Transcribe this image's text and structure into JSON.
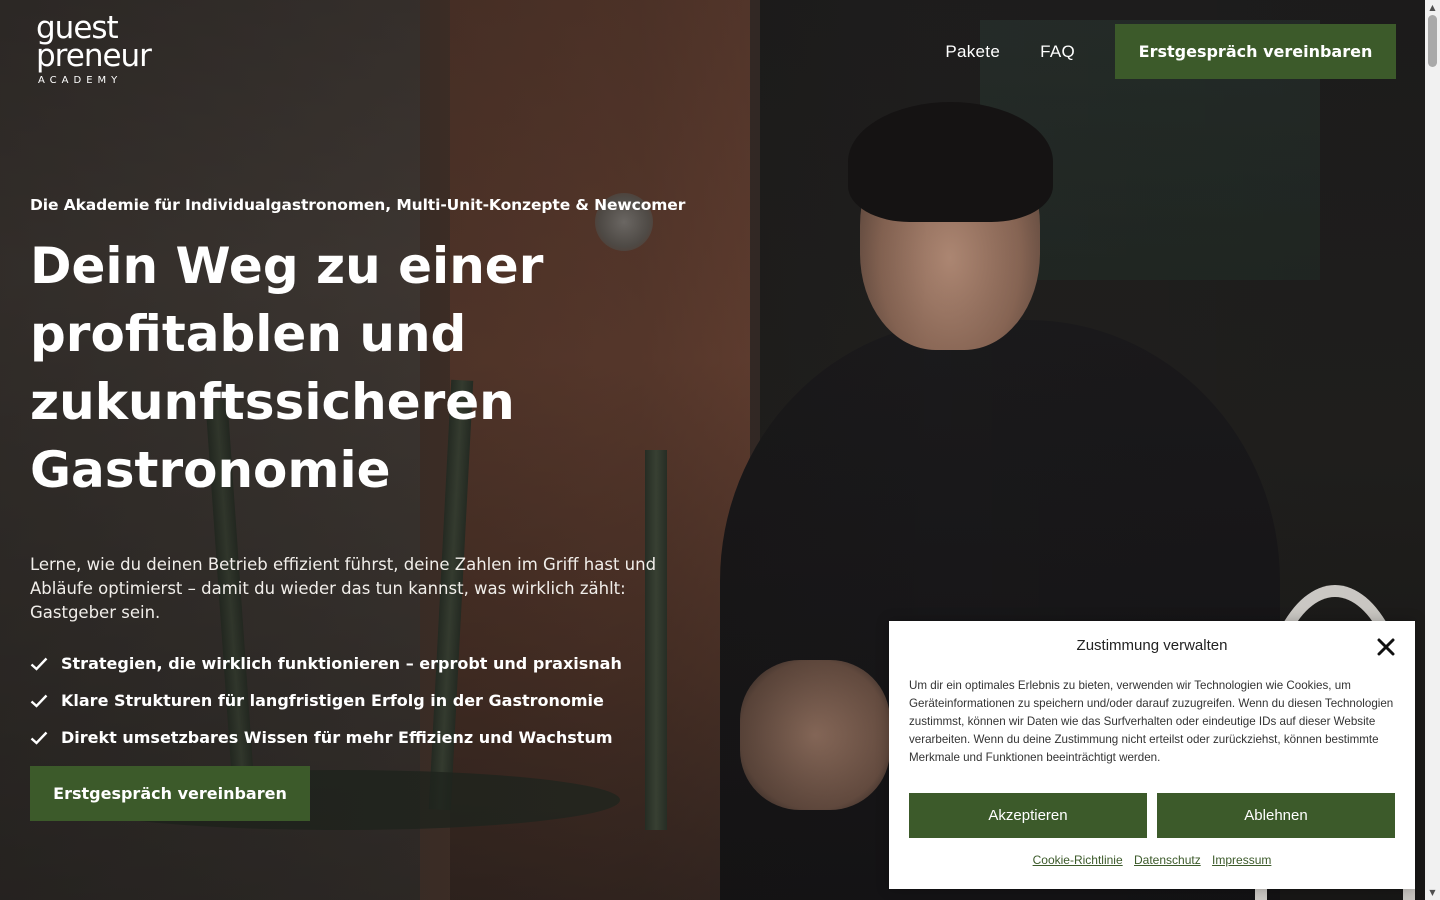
{
  "logo": {
    "line1": "guest",
    "line2": "preneur",
    "line3": "ACADEMY"
  },
  "nav": {
    "links": [
      "Pakete",
      "FAQ"
    ],
    "cta": "Erstgespräch vereinbaren"
  },
  "hero": {
    "eyebrow": "Die Akademie für Individualgastronomen, Multi-Unit-Konzepte & Newcomer",
    "headline_lines": [
      "Dein Weg zu einer",
      "profitablen und",
      "zukunftssicheren",
      "Gastronomie"
    ],
    "lead": "Lerne, wie du deinen Betrieb effizient führst, deine Zahlen im Griff hast und Abläufe optimierst – damit du wieder das tun kannst, was wirklich zählt: Gastgeber sein.",
    "checks": [
      "Strategien, die wirklich funktionieren – erprobt und praxisnah",
      "Klare Strukturen für langfristigen Erfolg in der Gastronomie",
      "Direkt umsetzbares Wissen für mehr Effizienz und Wachstum"
    ],
    "cta": "Erstgespräch vereinbaren"
  },
  "cookie": {
    "title": "Zustimmung verwalten",
    "text": "Um dir ein optimales Erlebnis zu bieten, verwenden wir Technologien wie Cookies, um Geräteinformationen zu speichern und/oder darauf zuzugreifen. Wenn du diesen Technologien zustimmst, können wir Daten wie das Surfverhalten oder eindeutige IDs auf dieser Website verarbeiten. Wenn du deine Zustimmung nicht erteilst oder zurückziehst, können bestimmte Merkmale und Funktionen beeinträchtigt werden.",
    "accept": "Akzeptieren",
    "deny": "Ablehnen",
    "links": [
      "Cookie-Richtlinie",
      "Datenschutz",
      "Impressum"
    ]
  },
  "colors": {
    "accent": "#3c5a2a",
    "text_light": "#ffffff",
    "dialog_bg": "#ffffff"
  }
}
